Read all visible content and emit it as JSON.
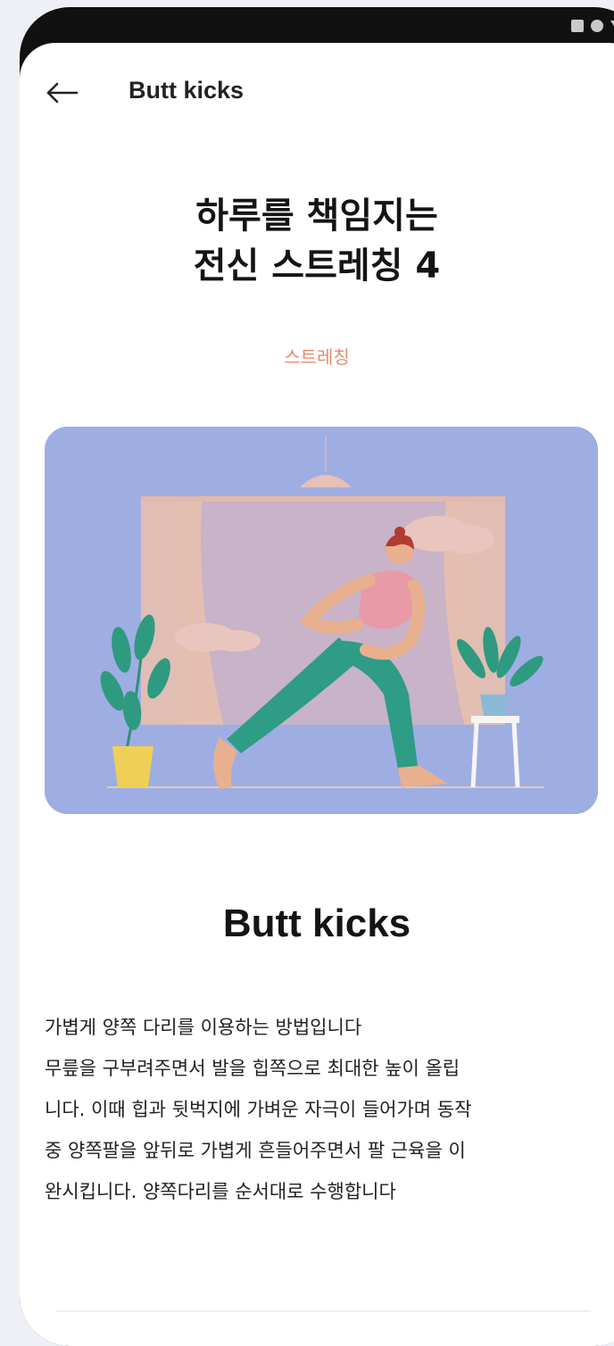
{
  "topbar": {
    "title": "Butt kicks"
  },
  "hero": {
    "title_line1": "하루를 책임지는",
    "title_line2": "전신 스트레칭 4",
    "category": "스트레칭"
  },
  "exercise": {
    "name": "Butt kicks",
    "description_lines": [
      "가볍게 양쪽 다리를 이용하는 방법입니다",
      "무릎을 구부려주면서 발을 힙쪽으로 최대한 높이 올립",
      "니다. 이때 힙과 뒷벅지에 가벼운 자극이 들어가며 동작",
      "중 양쪽팔을 앞뒤로 가볍게 흔들어주면서 팔 근육을 이",
      "완시킵니다.  양쪽다리를 순서대로 수행합니다"
    ]
  },
  "colors": {
    "accent": "#e88a70",
    "illustration_bg": "#9eaee3"
  },
  "icons": {
    "back": "arrow-left-icon"
  }
}
